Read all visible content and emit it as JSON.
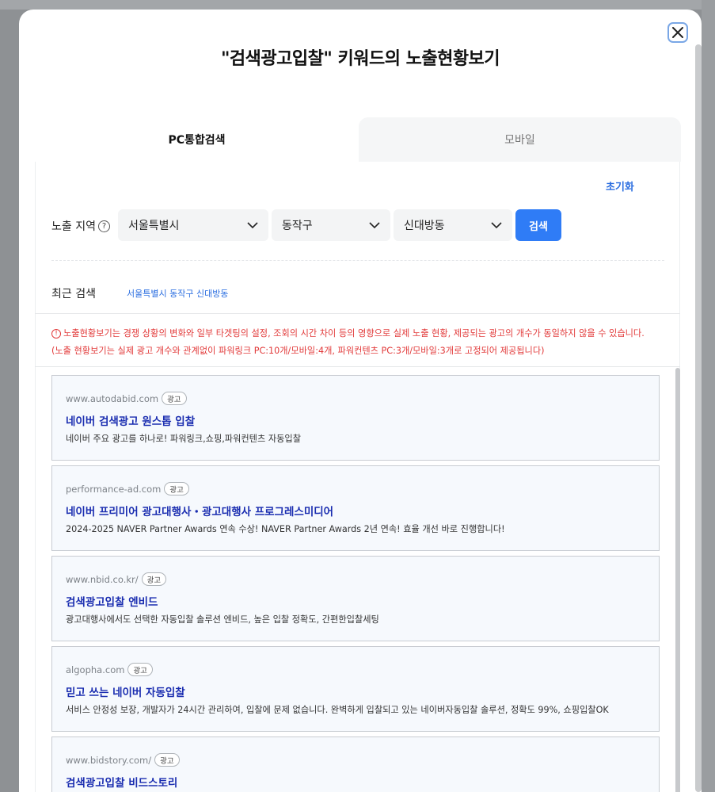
{
  "modal": {
    "title": "\"검색광고입찰\" 키워드의 노출현황보기",
    "tabs": [
      {
        "label": "PC통합검색",
        "active": true
      },
      {
        "label": "모바일",
        "active": false
      }
    ],
    "reset_label": "초기화",
    "region": {
      "label": "노출 지역",
      "help_icon": "question-circle-icon",
      "selects": [
        {
          "value": "서울특별시"
        },
        {
          "value": "동작구"
        },
        {
          "value": "신대방동"
        }
      ],
      "search_label": "검색"
    },
    "recent": {
      "label": "최근 검색",
      "item": "서울특별시 동작구 신대방동"
    },
    "notice": {
      "line1": "노출현황보기는 경쟁 상황의 변화와 일부 타겟팅의 설정, 조회의 시간 차이 등의 영향으로 실제 노출 현황, 제공되는 광고의 개수가 동일하지 않을 수 있습니다.",
      "line2": "(노출 현황보기는 실제 광고 개수와 관계없이 파워링크 PC:10개/모바일:4개, 파워컨텐츠 PC:3개/모바일:3개로 고정되어 제공됩니다)"
    },
    "ads": [
      {
        "url": "www.autodabid.com",
        "badge": "광고",
        "title": "네이버 검색광고 원스톱 입찰",
        "desc": "네이버 주요 광고를 하나로! 파워링크,쇼핑,파워컨텐츠 자동입찰"
      },
      {
        "url": "performance-ad.com",
        "badge": "광고",
        "title": "네이버 프리미어 광고대행사・광고대행사 프로그레스미디어",
        "desc": "2024-2025 NAVER Partner Awards 연속 수상! NAVER Partner Awards 2년 연속! 효율 개선 바로 진행합니다!"
      },
      {
        "url": "www.nbid.co.kr/",
        "badge": "광고",
        "title": "검색광고입찰 엔비드",
        "desc": "광고대행사에서도 선택한 자동입찰 솔루션 엔비드, 높은 입찰 정확도, 간편한입찰세팅"
      },
      {
        "url": "algopha.com",
        "badge": "광고",
        "title": "믿고 쓰는 네이버 자동입찰",
        "desc": "서비스 안정성 보장, 개발자가 24시간 관리하여, 입찰에 문제 없습니다. 완벽하게 입찰되고 있는 네이버자동입찰 솔루션, 정확도 99%, 쇼핑입찰OK"
      },
      {
        "url": "www.bidstory.com/",
        "badge": "광고",
        "title": "검색광고입찰 비드스토리",
        "desc": ""
      }
    ],
    "colors": {
      "accent": "#2f7cf6",
      "notice": "#e23a3a",
      "ad_title": "#1a2db0"
    }
  }
}
